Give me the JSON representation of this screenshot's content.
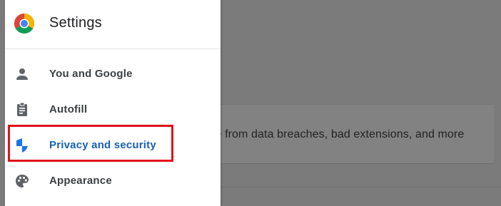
{
  "drawer": {
    "title": "Settings",
    "logo_icon": "chrome-logo-icon",
    "items": [
      {
        "label": "You and Google",
        "icon": "person-icon",
        "active": false
      },
      {
        "label": "Autofill",
        "icon": "clipboard-icon",
        "active": false
      },
      {
        "label": "Privacy and security",
        "icon": "shield-icon",
        "active": true
      },
      {
        "label": "Appearance",
        "icon": "palette-icon",
        "active": false
      }
    ]
  },
  "background": {
    "text": "afe from data breaches, bad extensions, and more"
  },
  "colors": {
    "accent": "#1a5fb4",
    "highlight": "#e0121b",
    "overlay": "#7b7b7b"
  }
}
